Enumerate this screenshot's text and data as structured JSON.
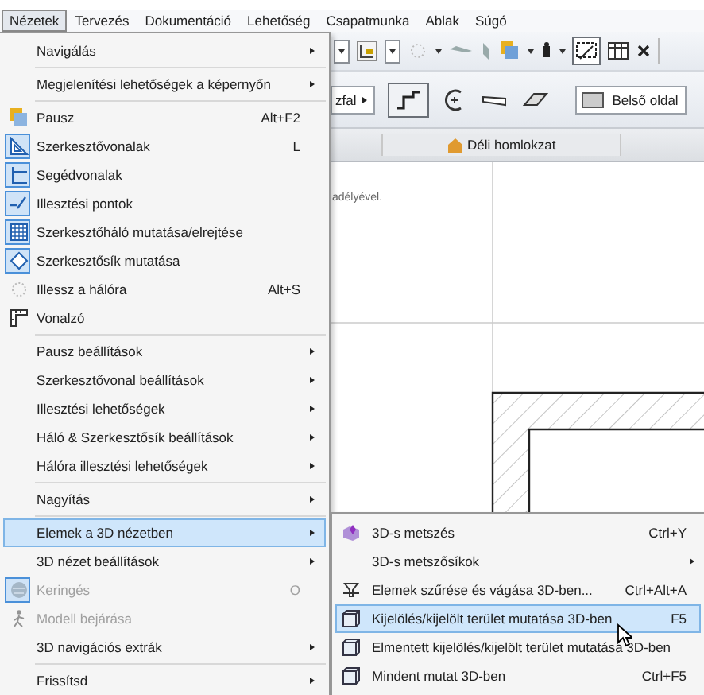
{
  "menu_bar": [
    {
      "label": "Nézetek",
      "selected": true
    },
    {
      "label": "Tervezés",
      "selected": false
    },
    {
      "label": "Dokumentáció",
      "selected": false
    },
    {
      "label": "Lehetőség",
      "selected": false
    },
    {
      "label": "Csapatmunka",
      "selected": false
    },
    {
      "label": "Ablak",
      "selected": false
    },
    {
      "label": "Súgó",
      "selected": false
    }
  ],
  "toolbar": {
    "wall_button": "zfal",
    "surface_dropdown": "Belső oldal"
  },
  "view_tab": {
    "label": "Déli homlokzat"
  },
  "canvas": {
    "note": "adélyével."
  },
  "menu": {
    "items": [
      {
        "kind": "item",
        "label": "Navigálás",
        "submenu": true,
        "selected": false,
        "disabled": false,
        "checked": false
      },
      {
        "kind": "separator"
      },
      {
        "kind": "item",
        "label": "Megjelenítési lehetőségek a képernyőn",
        "submenu": true,
        "selected": false,
        "disabled": false,
        "checked": false
      },
      {
        "kind": "separator"
      },
      {
        "kind": "item",
        "label": "Pausz",
        "shortcut": "Alt+F2",
        "submenu": false,
        "selected": false,
        "disabled": false,
        "checked": false
      },
      {
        "kind": "item",
        "label": "Szerkesztővonalak",
        "shortcut": "L",
        "submenu": false,
        "selected": false,
        "disabled": false,
        "checked": true
      },
      {
        "kind": "item",
        "label": "Segédvonalak",
        "submenu": false,
        "selected": false,
        "disabled": false,
        "checked": true
      },
      {
        "kind": "item",
        "label": "Illesztési pontok",
        "submenu": false,
        "selected": false,
        "disabled": false,
        "checked": true
      },
      {
        "kind": "item",
        "label": "Szerkesztőháló mutatása/elrejtése",
        "submenu": false,
        "selected": false,
        "disabled": false,
        "checked": true
      },
      {
        "kind": "item",
        "label": "Szerkesztősík mutatása",
        "submenu": false,
        "selected": false,
        "disabled": false,
        "checked": true
      },
      {
        "kind": "item",
        "label": "Illessz a hálóra",
        "shortcut": "Alt+S",
        "submenu": false,
        "selected": false,
        "disabled": false,
        "checked": false
      },
      {
        "kind": "item",
        "label": "Vonalzó",
        "submenu": false,
        "selected": false,
        "disabled": false,
        "checked": false
      },
      {
        "kind": "separator"
      },
      {
        "kind": "item",
        "label": "Pausz beállítások",
        "submenu": true,
        "selected": false,
        "disabled": false,
        "checked": false
      },
      {
        "kind": "item",
        "label": "Szerkesztővonal beállítások",
        "submenu": true,
        "selected": false,
        "disabled": false,
        "checked": false
      },
      {
        "kind": "item",
        "label": "Illesztési lehetőségek",
        "submenu": true,
        "selected": false,
        "disabled": false,
        "checked": false
      },
      {
        "kind": "item",
        "label": "Háló & Szerkesztősík beállítások",
        "submenu": true,
        "selected": false,
        "disabled": false,
        "checked": false
      },
      {
        "kind": "item",
        "label": "Hálóra illesztési lehetőségek",
        "submenu": true,
        "selected": false,
        "disabled": false,
        "checked": false
      },
      {
        "kind": "separator"
      },
      {
        "kind": "item",
        "label": "Nagyítás",
        "submenu": true,
        "selected": false,
        "disabled": false,
        "checked": false
      },
      {
        "kind": "separator"
      },
      {
        "kind": "item",
        "label": "Elemek a 3D nézetben",
        "submenu": true,
        "selected": true,
        "disabled": false,
        "checked": false
      },
      {
        "kind": "item",
        "label": "3D nézet beállítások",
        "submenu": true,
        "selected": false,
        "disabled": false,
        "checked": false
      },
      {
        "kind": "item",
        "label": "Keringés",
        "shortcut": "O",
        "submenu": false,
        "selected": false,
        "disabled": true,
        "checked": true
      },
      {
        "kind": "item",
        "label": "Modell bejárása",
        "submenu": false,
        "selected": false,
        "disabled": true,
        "checked": false
      },
      {
        "kind": "item",
        "label": "3D navigációs extrák",
        "submenu": true,
        "selected": false,
        "disabled": false,
        "checked": false
      },
      {
        "kind": "separator"
      },
      {
        "kind": "item",
        "label": "Frissítsd",
        "submenu": true,
        "selected": false,
        "disabled": false,
        "checked": false
      }
    ]
  },
  "submenu": {
    "items": [
      {
        "kind": "item",
        "label": "3D-s metszés",
        "shortcut": "Ctrl+Y",
        "submenu": false,
        "selected": false
      },
      {
        "kind": "item",
        "label": "3D-s metszősíkok",
        "submenu": true,
        "selected": false
      },
      {
        "kind": "item",
        "label": "Elemek szűrése és vágása 3D-ben...",
        "shortcut": "Ctrl+Alt+A",
        "submenu": false,
        "selected": false
      },
      {
        "kind": "item",
        "label": "Kijelölés/kijelölt terület mutatása 3D-ben",
        "shortcut": "F5",
        "submenu": false,
        "selected": true
      },
      {
        "kind": "item",
        "label": "Elmentett kijelölés/kijelölt terület mutatása 3D-ben",
        "submenu": false,
        "selected": false
      },
      {
        "kind": "item",
        "label": "Mindent mutat 3D-ben",
        "shortcut": "Ctrl+F5",
        "submenu": false,
        "selected": false
      }
    ]
  }
}
